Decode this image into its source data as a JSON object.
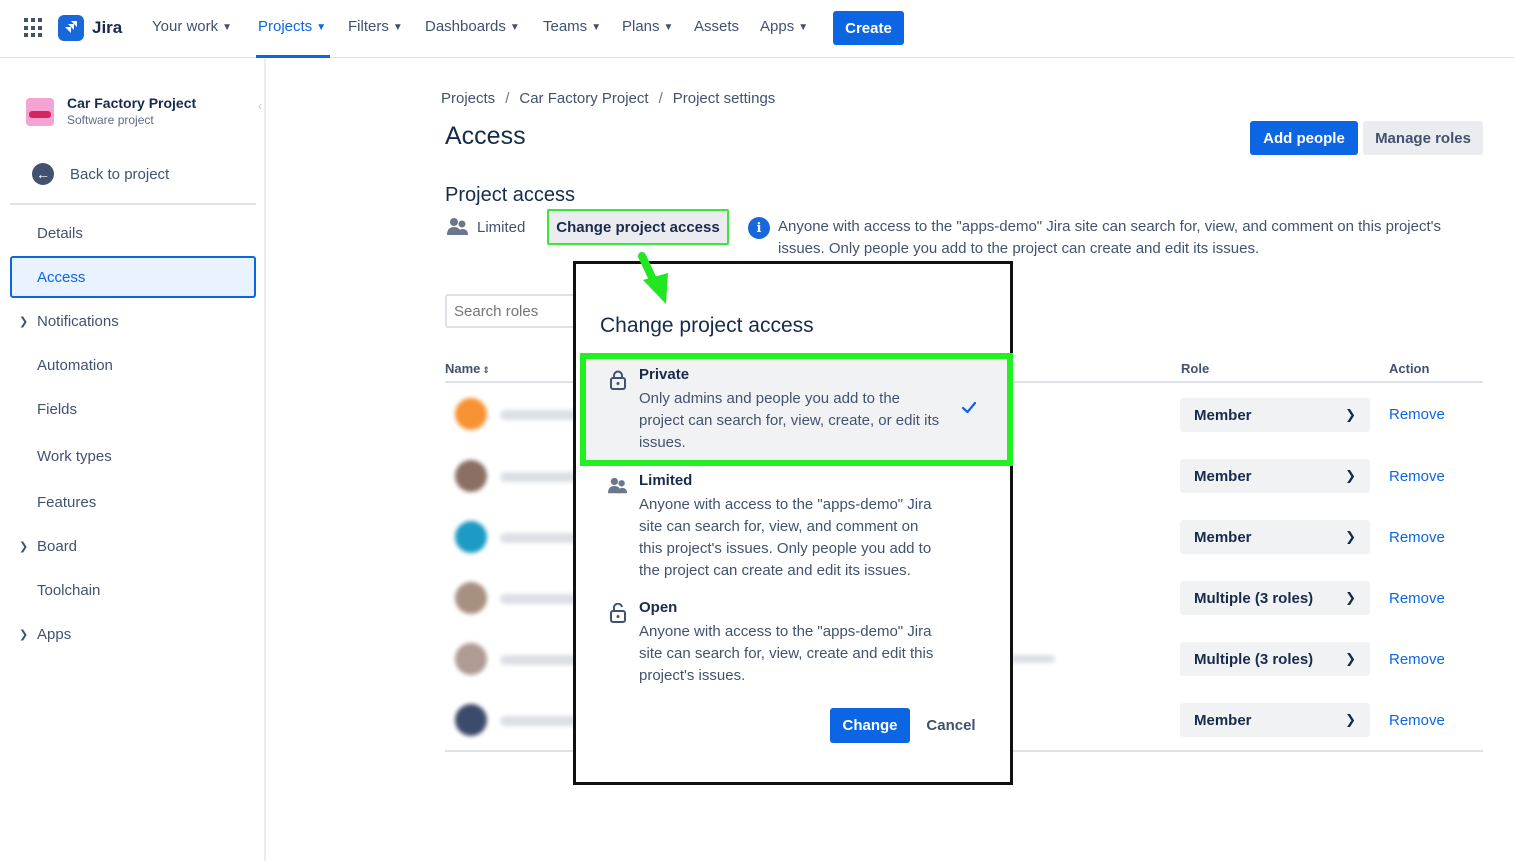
{
  "topnav": {
    "logo_text": "Jira",
    "items": [
      {
        "label": "Your work",
        "dropdown": true
      },
      {
        "label": "Projects",
        "dropdown": true,
        "active": true
      },
      {
        "label": "Filters",
        "dropdown": true
      },
      {
        "label": "Dashboards",
        "dropdown": true
      },
      {
        "label": "Teams",
        "dropdown": true
      },
      {
        "label": "Plans",
        "dropdown": true
      },
      {
        "label": "Assets",
        "dropdown": false
      },
      {
        "label": "Apps",
        "dropdown": true
      }
    ],
    "create_label": "Create"
  },
  "sidebar": {
    "project_name": "Car Factory Project",
    "project_type": "Software project",
    "back_label": "Back to project",
    "items": [
      {
        "label": "Details",
        "expandable": false
      },
      {
        "label": "Access",
        "expandable": false,
        "active": true
      },
      {
        "label": "Notifications",
        "expandable": true
      },
      {
        "label": "Automation",
        "expandable": false
      },
      {
        "label": "Fields",
        "expandable": false
      },
      {
        "label": "Work types",
        "expandable": false
      },
      {
        "label": "Features",
        "expandable": false
      },
      {
        "label": "Board",
        "expandable": true
      },
      {
        "label": "Toolchain",
        "expandable": false
      },
      {
        "label": "Apps",
        "expandable": true
      }
    ]
  },
  "breadcrumb": [
    "Projects",
    "Car Factory Project",
    "Project settings"
  ],
  "page": {
    "title": "Access",
    "add_people_label": "Add people",
    "manage_roles_label": "Manage roles",
    "section_title": "Project access",
    "current_access": "Limited",
    "change_access_label": "Change project access",
    "info_text": "Anyone with access to the \"apps-demo\" Jira site can search for, view, and comment on this project's issues. Only people you add to the project can create and edit its issues.",
    "search_placeholder": "Search roles"
  },
  "table": {
    "col_name": "Name",
    "col_role": "Role",
    "col_action": "Action",
    "rows": [
      {
        "role": "Member",
        "action": "Remove",
        "avatar_color": "#f79232"
      },
      {
        "role": "Member",
        "action": "Remove",
        "avatar_color": "#8b6f63"
      },
      {
        "role": "Member",
        "action": "Remove",
        "avatar_color": "#1d9bc4"
      },
      {
        "role": "Multiple (3 roles)",
        "action": "Remove",
        "avatar_color": "#a89080"
      },
      {
        "role": "Multiple (3 roles)",
        "action": "Remove",
        "avatar_color": "#b09a94"
      },
      {
        "role": "Member",
        "action": "Remove",
        "avatar_color": "#3c4a6b"
      }
    ]
  },
  "dialog": {
    "title": "Change project access",
    "options": [
      {
        "title": "Private",
        "desc": "Only admins and people you add to the project can search for, view, create, or edit its issues.",
        "icon": "lock-icon",
        "selected": true
      },
      {
        "title": "Limited",
        "desc": "Anyone with access to the \"apps-demo\" Jira site can search for, view, and comment on this project's issues. Only people you add to the project can create and edit its issues.",
        "icon": "people-icon",
        "selected": false
      },
      {
        "title": "Open",
        "desc": "Anyone with access to the \"apps-demo\" Jira site can search for, view, create and edit this project's issues.",
        "icon": "unlock-icon",
        "selected": false
      }
    ],
    "change_label": "Change",
    "cancel_label": "Cancel"
  },
  "colors": {
    "brand_blue": "#0c66e4",
    "annotation_green": "#22f022"
  }
}
